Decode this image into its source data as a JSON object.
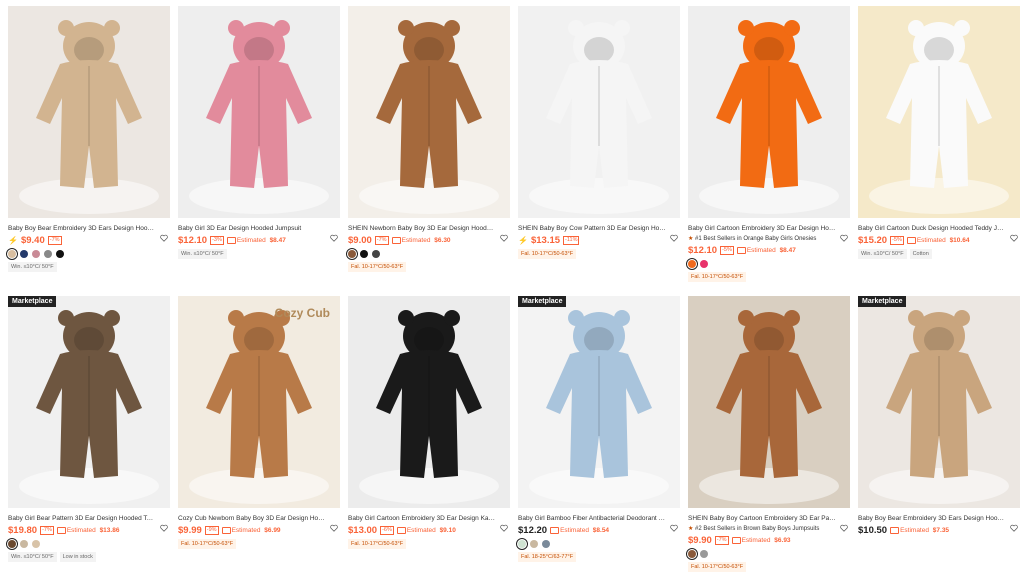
{
  "products": [
    {
      "title": "Baby Boy Bear Embroidery 3D Ears Design Hooded Fo...",
      "flash": true,
      "price": "$9.40",
      "discount": "-7%",
      "estimated": "",
      "best": "",
      "swatches": [
        "#d9bfa0",
        "#243a6b",
        "#c98a96",
        "#888888",
        "#111111"
      ],
      "tags": [
        "Win. ≤10°C/ 50°F"
      ],
      "bg": "#ece7e2",
      "garment": "#d2b490",
      "marketplace": false
    },
    {
      "title": "Baby Girl 3D Ear Design Hooded Jumpsuit",
      "flash": false,
      "price": "$12.10",
      "discount": "-3%",
      "estimated": "$8.47",
      "best": "",
      "swatches": [],
      "tags": [
        "Win. ≤10°C/ 50°F"
      ],
      "bg": "#eeeeee",
      "garment": "#e28b9c",
      "marketplace": false
    },
    {
      "title": "SHEIN Newborn Baby Boy 3D Ear Design Hooded Zip...",
      "flash": false,
      "price": "$9.00",
      "discount": "-7%",
      "estimated": "$6.30",
      "best": "",
      "swatches": [
        "#8a5a3a",
        "#111111",
        "#444444"
      ],
      "tags": [
        "Fal. 10-17°C/50-63°F"
      ],
      "bg": "#f3efe9",
      "garment": "#a5693c",
      "marketplace": false
    },
    {
      "title": "SHEIN Baby Boy Cow Pattern 3D Ear Design Hooded ...",
      "flash": true,
      "price": "$13.15",
      "discount": "-11%",
      "estimated": "",
      "best": "",
      "swatches": [],
      "tags": [
        "Fal. 10-17°C/50-63°F"
      ],
      "bg": "#f1f1f1",
      "garment": "#f5f5f5",
      "marketplace": false
    },
    {
      "title": "Baby Girl Cartoon Embroidery 3D Ear Design Hooded ...",
      "flash": false,
      "price": "$12.10",
      "discount": "-5%",
      "estimated": "$8.47",
      "best": "#1 Best Sellers in Orange Baby Girls Onesies",
      "swatches": [
        "#f06a1d",
        "#e8336b"
      ],
      "tags": [
        "Fal. 10-17°C/50-63°F"
      ],
      "bg": "#eeeeee",
      "garment": "#f26b13",
      "marketplace": false
    },
    {
      "title": "Baby Girl Cartoon Duck Design Hooded Teddy Jumpsuit",
      "flash": false,
      "price": "$15.20",
      "discount": "-5%",
      "estimated": "$10.64",
      "best": "",
      "swatches": [],
      "tags": [
        "Win. ≤10°C/ 50°F",
        "Cotton"
      ],
      "bg": "#f5e9c9",
      "garment": "#fafafa",
      "marketplace": false
    },
    {
      "title": "Baby Girl Bear Pattern 3D Ear Design Hooded Teddy J...",
      "flash": false,
      "price": "$19.80",
      "discount": "-7%",
      "estimated": "$13.86",
      "best": "",
      "swatches": [
        "#6b4a30",
        "#c9b8a0",
        "#d8c3a8"
      ],
      "tags": [
        "Win. ≤10°C/ 50°F",
        "Low in stock"
      ],
      "bg": "#f0f0f0",
      "garment": "#6e5640",
      "marketplace": true
    },
    {
      "title": "Cozy Cub Newborn Baby Boy 3D Ear Design Hooded T...",
      "flash": false,
      "price": "$9.99",
      "discount": "-9%",
      "estimated": "$6.99",
      "best": "",
      "swatches": [],
      "tags": [
        "Fal. 10-17°C/50-63°F"
      ],
      "bg": "#f2ebe0",
      "garment": "#b87a48",
      "marketplace": false,
      "overlay": "Cozy Cub"
    },
    {
      "title": "Baby Girl Cartoon Embroidery 3D Ear Design Kangaro...",
      "flash": false,
      "price": "$13.00",
      "discount": "-6%",
      "estimated": "$9.10",
      "best": "",
      "swatches": [],
      "tags": [
        "Fal. 10-17°C/50-63°F"
      ],
      "bg": "#ececec",
      "garment": "#1a1a1a",
      "marketplace": false
    },
    {
      "title": "Baby Girl Bamboo Fiber Antibacterial Deodorant Mite-p...",
      "flash": false,
      "price": "$12.20",
      "discount": "",
      "estimated": "$8.54",
      "best": "",
      "swatches": [
        "#cfe3d2",
        "#c9b8a0",
        "#7a8a9a"
      ],
      "tags": [
        "Fal. 18-25°C/63-77°F"
      ],
      "bg": "#f3f3f3",
      "garment": "#a9c4dc",
      "marketplace": true
    },
    {
      "title": "SHEIN Baby Boy Cartoon Embroidery 3D Ear Patched ...",
      "flash": false,
      "price": "$9.90",
      "discount": "-7%",
      "estimated": "$6.93",
      "best": "#2 Best Sellers in Brown Baby Boys Jumpsuits",
      "swatches": [
        "#8a5a3a",
        "#999999"
      ],
      "tags": [
        "Fal. 10-17°C/50-63°F"
      ],
      "bg": "#d9cfc1",
      "garment": "#a8673a",
      "marketplace": false
    },
    {
      "title": "Baby Boy Bear Embroidery 3D Ears Design Hooded Fo...",
      "flash": false,
      "price": "$10.50",
      "discount": "",
      "estimated": "$7.35",
      "best": "",
      "swatches": [],
      "tags": [],
      "bg": "#ece7e2",
      "garment": "#c9a57e",
      "marketplace": true
    }
  ],
  "labels": {
    "marketplace": "Marketplace",
    "estimated": "Estimated"
  },
  "icons": {
    "wishlist": "heart-outline-icon",
    "flash": "lightning-icon",
    "coupon": "coupon-icon"
  }
}
